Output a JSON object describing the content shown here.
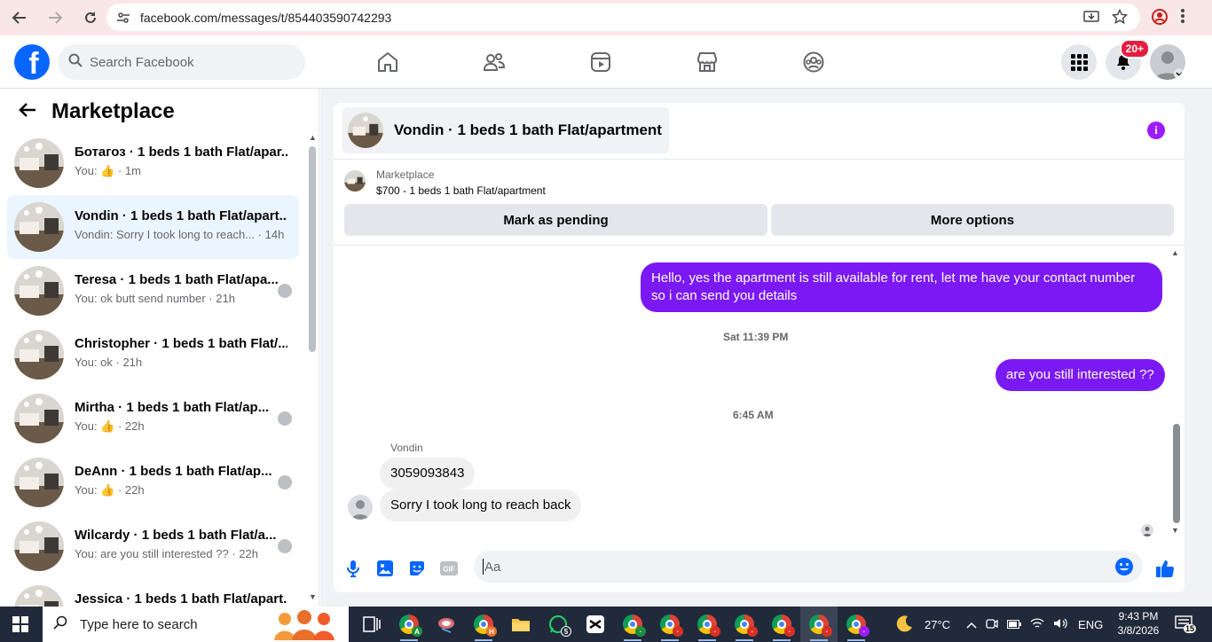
{
  "browser": {
    "url": "facebook.com/messages/t/854403590742293"
  },
  "header": {
    "search_placeholder": "Search Facebook",
    "notification_badge": "20+"
  },
  "sidebar": {
    "title": "Marketplace",
    "conversations": [
      {
        "name": "Ботагоз · 1 beds 1 bath Flat/apar...",
        "sub": "You: 👍 · 1m",
        "active": false
      },
      {
        "name": "Vondin · 1 beds 1 bath Flat/apart...",
        "sub": "Vondin: Sorry I took long to reach... · 14h",
        "active": true
      },
      {
        "name": "Teresa · 1 beds 1 bath Flat/apa...",
        "sub": "You: ok butt send number · 21h",
        "active": false
      },
      {
        "name": "Christopher · 1 beds 1 bath Flat/...",
        "sub": "You: ok · 21h",
        "active": false
      },
      {
        "name": "Mirtha · 1 beds 1 bath Flat/ap...",
        "sub": "You: 👍 · 22h",
        "active": false
      },
      {
        "name": "DeAnn · 1 beds 1 bath Flat/ap...",
        "sub": "You: 👍 · 22h",
        "active": false
      },
      {
        "name": "Wilcardy · 1 beds 1 bath Flat/a...",
        "sub": "You: are you still interested ?? · 22h",
        "active": false
      },
      {
        "name": "Jessica · 1 beds 1 bath Flat/apart...",
        "sub": "",
        "active": false
      }
    ]
  },
  "chat": {
    "title": "Vondin · 1 beds 1 bath Flat/apartment",
    "listing_label": "Marketplace",
    "listing_price": "$700 - 1 beds 1 bath Flat/apartment",
    "mark_pending_label": "Mark as pending",
    "more_options_label": "More options",
    "messages": {
      "out1": "Hello, yes the apartment is still available for rent, let me have your contact number so i can send you details",
      "ts1": "Sat 11:39 PM",
      "out2": "are you still interested ??",
      "ts2": "6:45 AM",
      "sender": "Vondin",
      "in1": "3059093843",
      "in2": "Sorry I took long to reach back"
    },
    "composer_placeholder": "Aa"
  },
  "taskbar": {
    "search_placeholder": "Type here to search",
    "whatsapp_count": "5",
    "weather": "27°C",
    "language": "ENG",
    "time": "9:43 PM",
    "date": "3/8/2026",
    "notification_count": "15"
  },
  "colors": {
    "fb_blue": "#0866ff",
    "outgoing_bubble": "#7b19f5",
    "info_purple": "#9e1bff"
  }
}
